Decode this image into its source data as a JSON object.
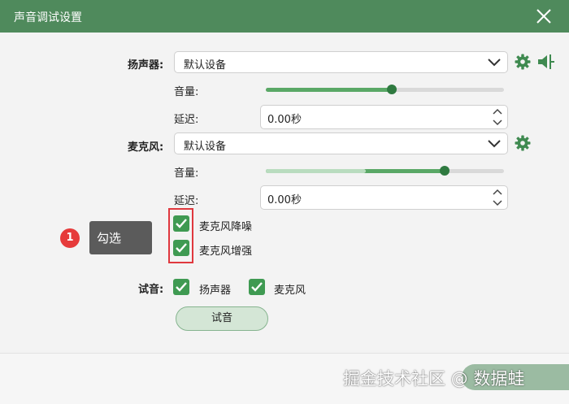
{
  "window": {
    "title": "声音调试设置"
  },
  "speaker": {
    "label": "扬声器:",
    "device": "默认设备",
    "volume_label": "音量:",
    "volume_level": 0.53,
    "delay_label": "延迟:",
    "delay_value": "0.00秒"
  },
  "microphone": {
    "label": "麦克风:",
    "device": "默认设备",
    "volume_label": "音量:",
    "volume_level": 0.75,
    "input_level": 0.42,
    "delay_label": "延迟:",
    "delay_value": "0.00秒"
  },
  "options": {
    "noise_reduction": {
      "label": "麦克风降噪",
      "checked": true
    },
    "enhancement": {
      "label": "麦克风增强",
      "checked": true
    }
  },
  "annotation": {
    "step": "1",
    "text": "勾选"
  },
  "test": {
    "label": "试音:",
    "speaker": {
      "label": "扬声器",
      "checked": true
    },
    "microphone": {
      "label": "麦克风",
      "checked": true
    },
    "button": "试音"
  },
  "watermark": "掘金技术社区 @ 数据蛙",
  "colors": {
    "accent": "#4f8a5c",
    "slider_fill": "#5aa866",
    "checkbox": "#3f9a52",
    "callout_red": "#e63b3b"
  }
}
